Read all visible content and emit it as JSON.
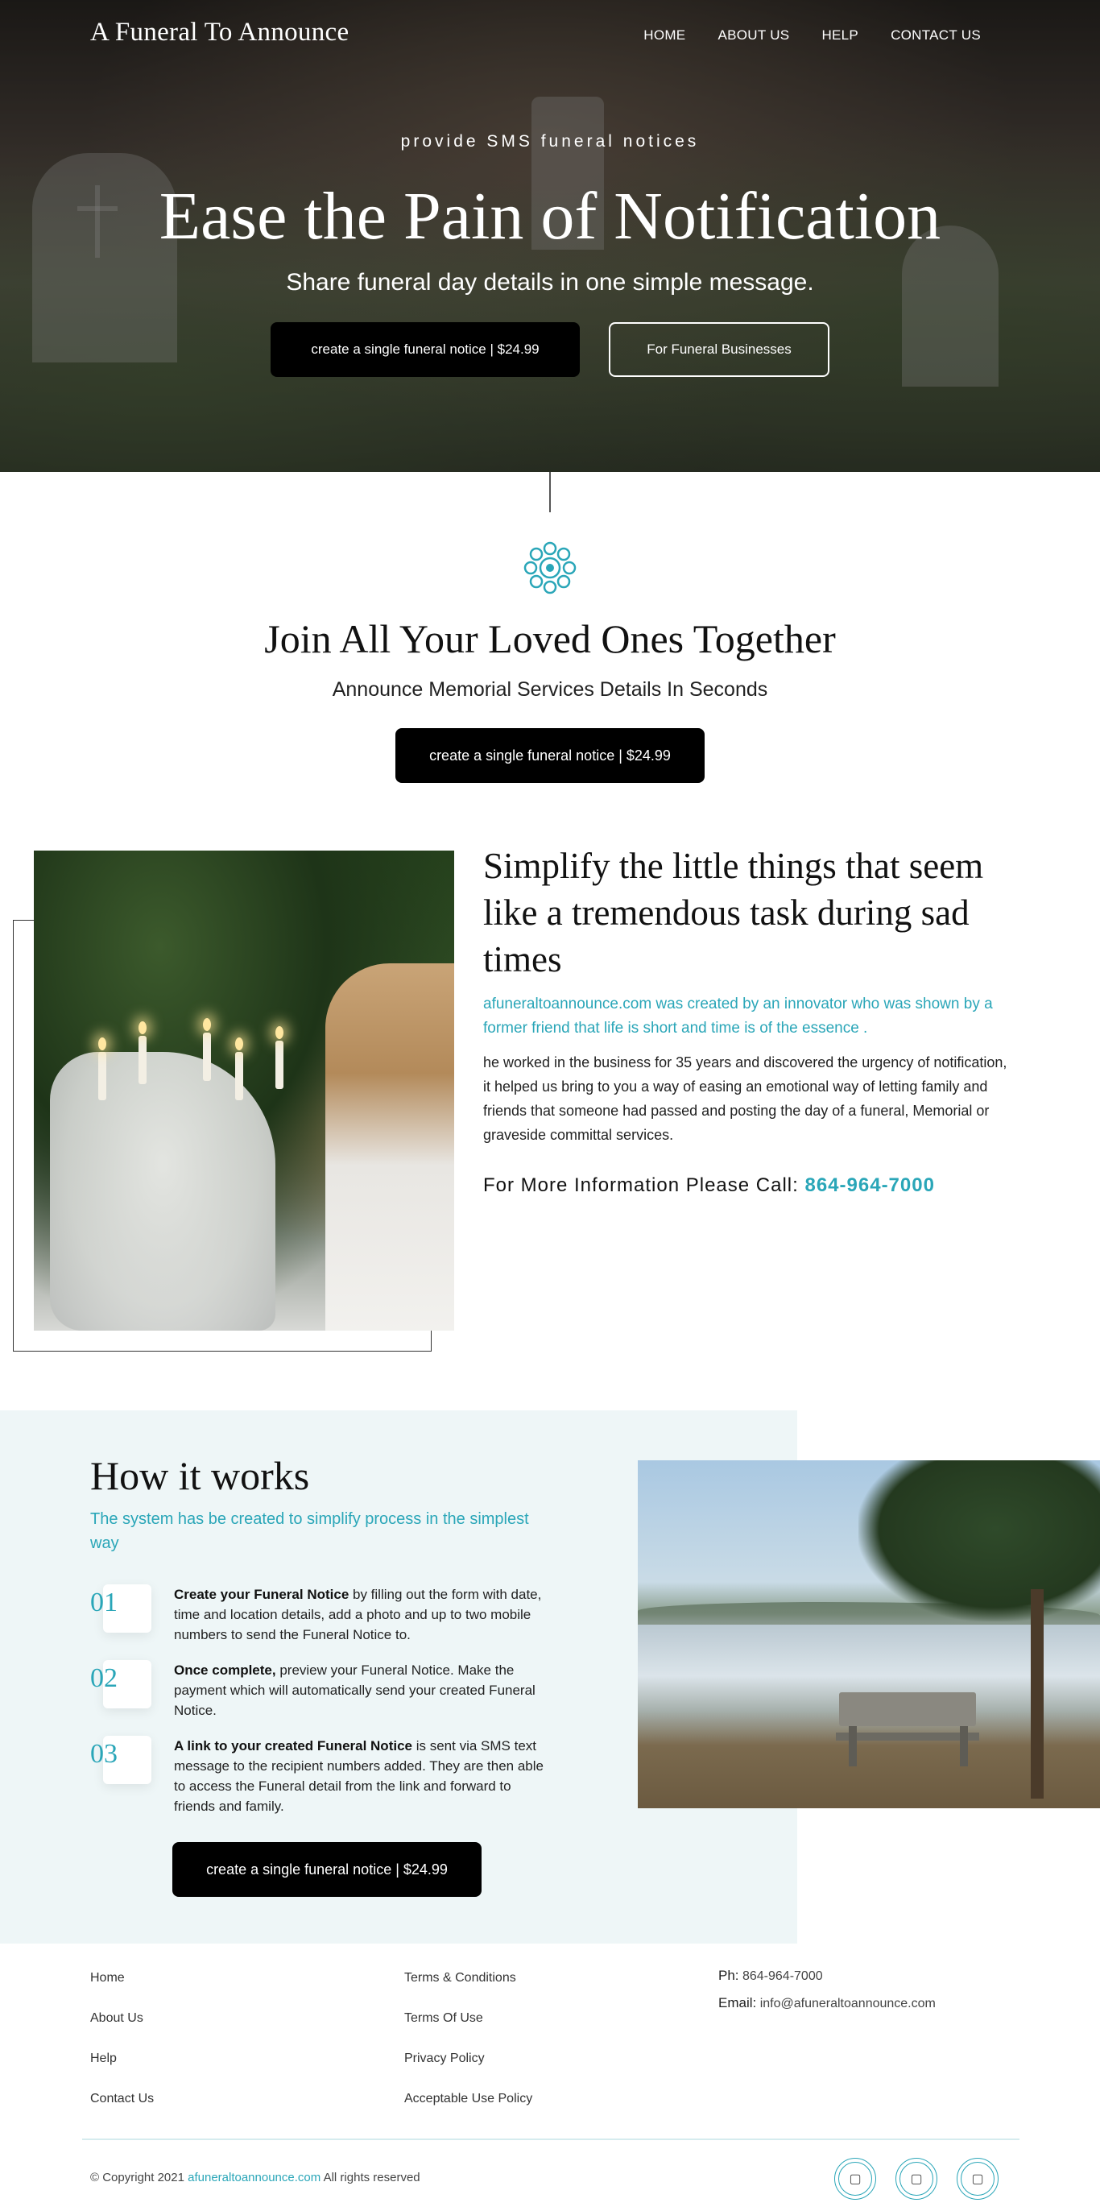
{
  "header": {
    "logo": "A Funeral To Announce",
    "nav": [
      "HOME",
      "ABOUT US",
      "HELP",
      "CONTACT US"
    ]
  },
  "hero": {
    "kicker": "provide SMS funeral notices",
    "title": "Ease the Pain of Notification",
    "subtitle": "Share funeral day details in one simple message.",
    "primary_button": "create a single funeral notice | $24.99",
    "secondary_button": "For Funeral Businesses"
  },
  "join": {
    "title": "Join All Your Loved Ones Together",
    "subtitle": "Announce Memorial Services Details In Seconds",
    "button": "create a single funeral notice | $24.99"
  },
  "simplify": {
    "title": "Simplify the little things that seem like a tremendous task during sad times",
    "teal_text": "afuneraltoannounce.com was created by an innovator who was shown by a former friend that life is short and time is of the essence .",
    "body": "he worked in the business for 35 years and discovered the urgency of notification, it helped us bring to you a way of easing an emotional way of letting family and friends that someone had passed and posting the day of a funeral, Memorial or graveside committal services.",
    "call_label": "For More Information Please Call:",
    "phone": "864-964-7000"
  },
  "how": {
    "title": "How it works",
    "subtitle": "The system has be created to simplify process in the simplest way",
    "steps": [
      {
        "num": "01",
        "bold": "Create your Funeral Notice",
        "text": " by filling out the form with date, time and location details, add a photo and up to two mobile numbers to send the Funeral Notice to."
      },
      {
        "num": "02",
        "bold": "Once complete,",
        "text": " preview your Funeral Notice. Make the payment which will automatically send your created Funeral Notice."
      },
      {
        "num": "03",
        "bold": "A link to your created Funeral Notice",
        "text": " is sent via SMS text message to the recipient numbers added. They are then able to access the Funeral detail from the link and forward to friends and family."
      }
    ],
    "button": "create a single funeral notice | $24.99"
  },
  "footer": {
    "col1": [
      "Home",
      "About Us",
      "Help",
      "Contact Us"
    ],
    "col2": [
      "Terms & Conditions",
      "Terms Of Use",
      "Privacy Policy",
      "Acceptable Use Policy"
    ],
    "phone_label": "Ph:",
    "phone": "864-964-7000",
    "email_label": "Email:",
    "email": "info@afuneraltoannounce.com",
    "copyright_prefix": "© Copyright 2021",
    "copyright_link": "afuneraltoannounce.com",
    "copyright_suffix": "All rights reserved",
    "social_glyph": "▢"
  },
  "colors": {
    "accent": "#2aa6b8",
    "button": "#000000",
    "how_bg": "#eef6f7"
  }
}
